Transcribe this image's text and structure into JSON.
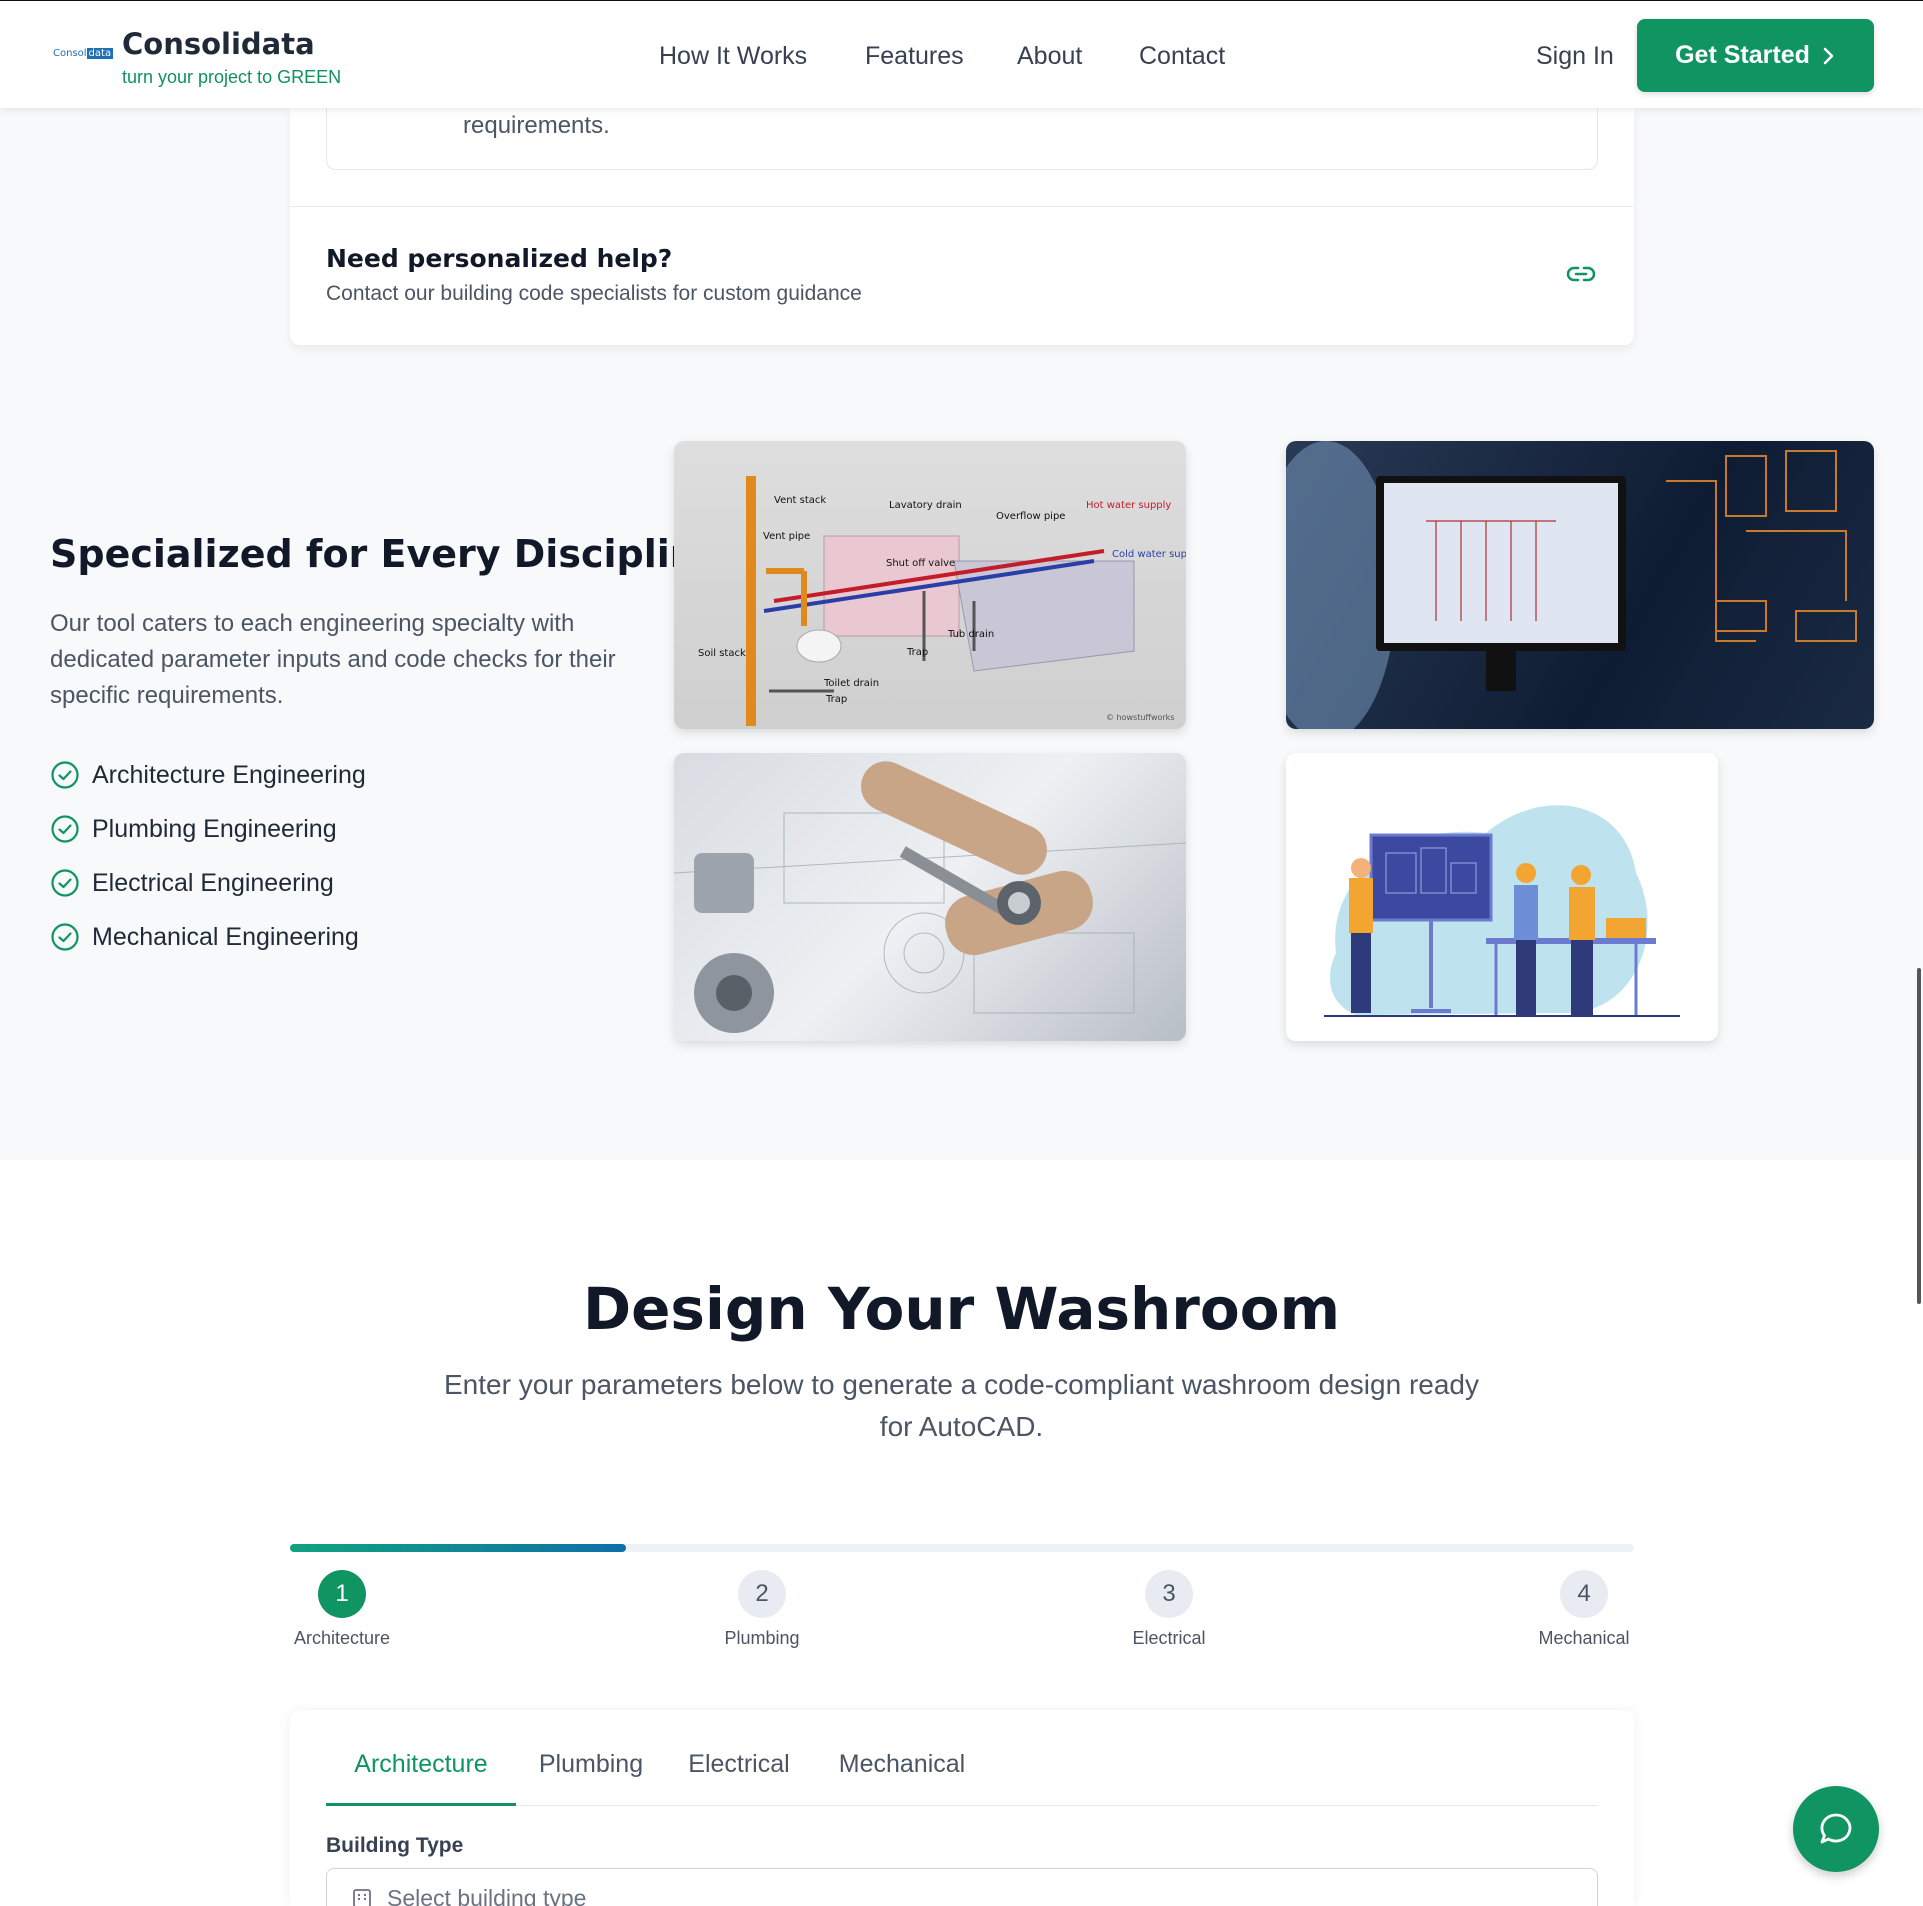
{
  "header": {
    "logo_text_a": "Consol",
    "logo_text_b": "data",
    "brand_name": "Consolidata",
    "tagline": "turn your project to GREEN",
    "nav": [
      "How It Works",
      "Features",
      "About",
      "Contact"
    ],
    "sign_in": "Sign In",
    "cta": "Get Started"
  },
  "help": {
    "requirements_tail": "requirements.",
    "title": "Need personalized help?",
    "subtitle": "Contact our building code specialists for custom guidance",
    "icon": "link-icon"
  },
  "disciplines": {
    "title": "Specialized for Every Discipline",
    "description": "Our tool caters to each engineering specialty with dedicated parameter inputs and code checks for their specific requirements.",
    "items": [
      "Architecture Engineering",
      "Plumbing Engineering",
      "Electrical Engineering",
      "Mechanical Engineering"
    ],
    "diagram_labels": [
      "Vent stack",
      "Vent pipe",
      "Lavatory drain",
      "Overflow pipe",
      "Hot water supply",
      "Cold water supply",
      "Shut off valve",
      "Tub drain",
      "Trap",
      "Soil stack",
      "Toilet drain",
      "Trap",
      "© howstuffworks"
    ]
  },
  "design": {
    "title": "Design Your Washroom",
    "subtitle": "Enter your parameters below to generate a code-compliant washroom design ready for AutoCAD.",
    "progress_fraction": 0.25,
    "steps": [
      {
        "number": "1",
        "label": "Architecture"
      },
      {
        "number": "2",
        "label": "Plumbing"
      },
      {
        "number": "3",
        "label": "Electrical"
      },
      {
        "number": "4",
        "label": "Mechanical"
      }
    ],
    "tabs": [
      "Architecture",
      "Plumbing",
      "Electrical",
      "Mechanical"
    ],
    "field_label": "Building Type",
    "select_placeholder": "Select building type"
  },
  "colors": {
    "accent": "#0f9462",
    "accent_text": "#10925c",
    "background_grey": "#f8f9fb"
  }
}
